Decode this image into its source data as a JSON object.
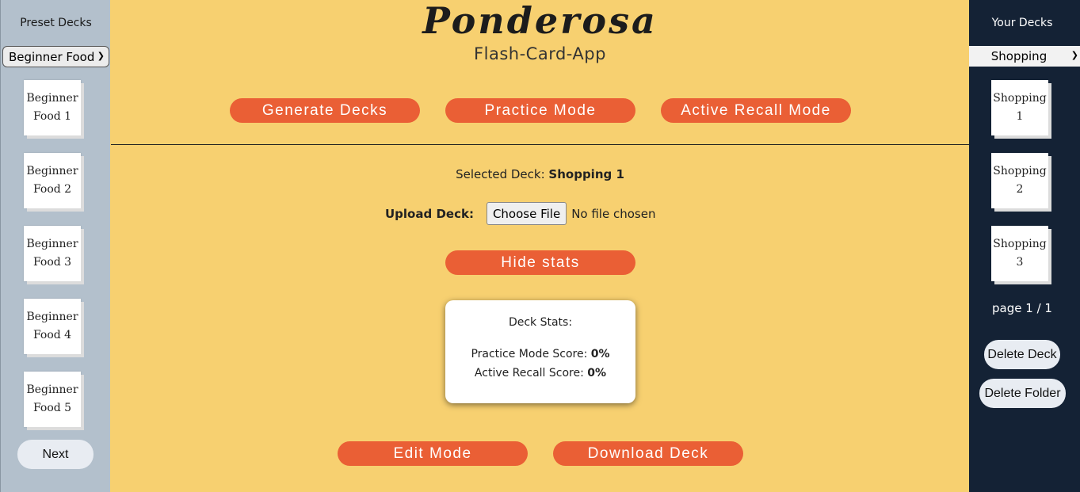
{
  "left": {
    "title": "Preset Decks",
    "select_value": "Beginner Food",
    "decks": [
      "Beginner Food 1",
      "Beginner Food 2",
      "Beginner Food 3",
      "Beginner Food 4",
      "Beginner Food 5"
    ],
    "next_label": "Next"
  },
  "main": {
    "title": "Ponderosa",
    "subtitle": "Flash-Card-App",
    "nav": [
      "Generate Decks",
      "Practice Mode",
      "Active Recall Mode"
    ],
    "selected_label": "Selected Deck:",
    "selected_value": "Shopping 1",
    "upload_label": "Upload Deck:",
    "choose_file": "Choose File",
    "no_file": "No file chosen",
    "hide_stats": "Hide stats",
    "stats": {
      "title": "Deck Stats:",
      "practice_label": "Practice Mode Score:",
      "practice_value": "0%",
      "recall_label": "Active Recall Score:",
      "recall_value": "0%"
    },
    "edit_mode": "Edit Mode",
    "download_deck": "Download Deck"
  },
  "right": {
    "title": "Your Decks",
    "select_value": "Shopping",
    "decks": [
      "Shopping 1",
      "Shopping 2",
      "Shopping 3"
    ],
    "page_label": "page 1 / 1",
    "delete_deck": "Delete Deck",
    "delete_folder": "Delete Folder"
  },
  "colors": {
    "main_bg": "#f7d070",
    "accent": "#ea5f35",
    "left_bg": "#b3c0cc",
    "right_bg": "#142235"
  }
}
